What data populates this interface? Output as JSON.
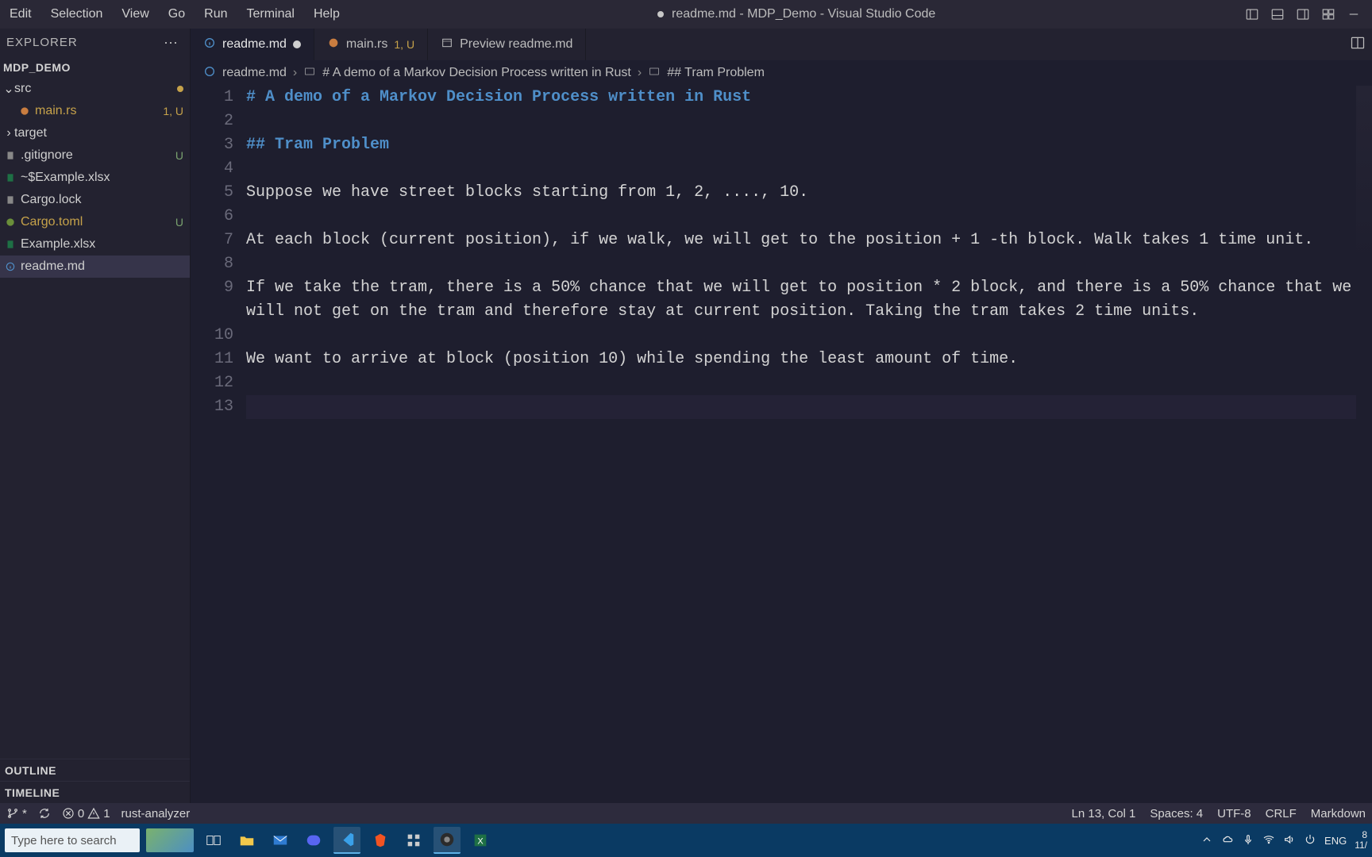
{
  "window": {
    "title": "readme.md - MDP_Demo - Visual Studio Code",
    "dirty": true
  },
  "menubar": [
    "Edit",
    "Selection",
    "View",
    "Go",
    "Run",
    "Terminal",
    "Help"
  ],
  "sidebar": {
    "title": "EXPLORER",
    "project": "MDP_DEMO",
    "tree": [
      {
        "label": "src",
        "kind": "folder",
        "expanded": true,
        "git": "dot"
      },
      {
        "label": "main.rs",
        "kind": "file-rust",
        "indent": 1,
        "git": "1, U"
      },
      {
        "label": "target",
        "kind": "folder",
        "expanded": false
      },
      {
        "label": ".gitignore",
        "kind": "file",
        "git": "U"
      },
      {
        "label": "~$Example.xlsx",
        "kind": "file-xlsx"
      },
      {
        "label": "Cargo.lock",
        "kind": "file"
      },
      {
        "label": "Cargo.toml",
        "kind": "file-toml",
        "git": "U",
        "gitmod": true
      },
      {
        "label": "Example.xlsx",
        "kind": "file-xlsx"
      },
      {
        "label": "readme.md",
        "kind": "file-md",
        "selected": true
      }
    ],
    "panels": [
      "OUTLINE",
      "TIMELINE"
    ]
  },
  "tabs": [
    {
      "label": "readme.md",
      "kind": "md",
      "active": true,
      "dirty": true
    },
    {
      "label": "main.rs",
      "kind": "rust",
      "git": "1, U"
    },
    {
      "label": "Preview readme.md",
      "kind": "preview"
    }
  ],
  "breadcrumbs": {
    "file": "readme.md",
    "h1": "# A demo of a Markov Decision Process written in Rust",
    "h2": "## Tram Problem"
  },
  "editor": {
    "lines": [
      {
        "n": 1,
        "cls": "md-h1",
        "text": "# A demo of a Markov Decision Process written in Rust"
      },
      {
        "n": 2,
        "text": ""
      },
      {
        "n": 3,
        "cls": "md-h2",
        "text": "## Tram Problem"
      },
      {
        "n": 4,
        "text": ""
      },
      {
        "n": 5,
        "text": "Suppose we have street blocks starting from 1, 2, ...., 10."
      },
      {
        "n": 6,
        "text": ""
      },
      {
        "n": 7,
        "text": "At each block (current position), if we walk, we will get to the position + 1 -th block. Walk takes 1 time unit."
      },
      {
        "n": 8,
        "text": ""
      },
      {
        "n": 9,
        "text": "If we take the tram, there is a 50% chance that we will get to position * 2 block, and there is a 50% chance that we will not get on the tram and therefore stay at current position. Taking the tram takes 2 time units."
      },
      {
        "n": 10,
        "text": ""
      },
      {
        "n": 11,
        "text": "We want to arrive at block (position 10) while spending the least amount of time."
      },
      {
        "n": 12,
        "text": ""
      },
      {
        "n": 13,
        "text": "",
        "current": true
      }
    ]
  },
  "status": {
    "branch_star": "*",
    "errors": "0",
    "warnings": "1",
    "analyzer": "rust-analyzer",
    "pos": "Ln 13, Col 1",
    "spaces": "Spaces: 4",
    "encoding": "UTF-8",
    "eol": "CRLF",
    "lang": "Markdown"
  },
  "taskbar": {
    "search_placeholder": "Type here to search",
    "lang": "ENG",
    "time": "8",
    "date": "11/"
  }
}
